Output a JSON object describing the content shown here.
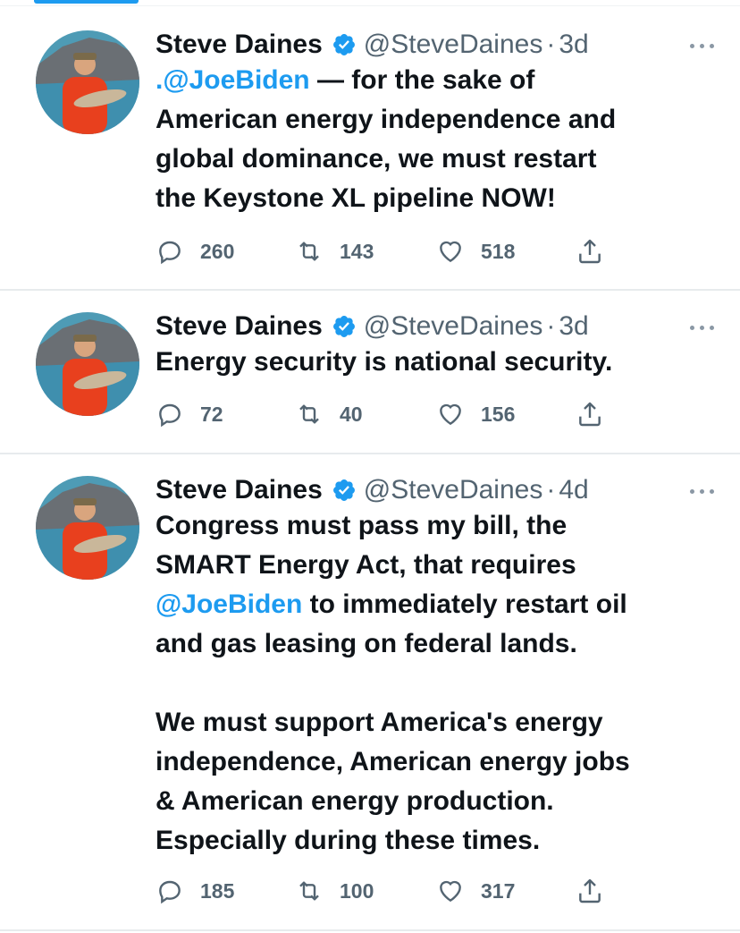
{
  "tweets": [
    {
      "author_name": "Steve Daines",
      "handle": "@SteveDaines",
      "separator": "·",
      "time": "3d",
      "text_parts": [
        {
          "t": ".@JoeBiden",
          "m": true
        },
        {
          "t": " — for the sake of\nAmerican energy independence and\nglobal dominance, we must restart\nthe Keystone XL pipeline NOW!",
          "m": false
        }
      ],
      "replies": "260",
      "retweets": "143",
      "likes": "518"
    },
    {
      "author_name": "Steve Daines",
      "handle": "@SteveDaines",
      "separator": "·",
      "time": "3d",
      "text_parts": [
        {
          "t": "Energy security is national security.",
          "m": false
        }
      ],
      "replies": "72",
      "retweets": "40",
      "likes": "156"
    },
    {
      "author_name": "Steve Daines",
      "handle": "@SteveDaines",
      "separator": "·",
      "time": "4d",
      "text_parts": [
        {
          "t": "Congress must pass my bill, the\nSMART Energy Act, that requires\n",
          "m": false
        },
        {
          "t": "@JoeBiden",
          "m": true
        },
        {
          "t": " to immediately restart oil\nand gas leasing on federal lands.\n\nWe must support America's energy\nindependence, American energy jobs\n& American energy production.\nEspecially during these times.",
          "m": false
        }
      ],
      "replies": "185",
      "retweets": "100",
      "likes": "317"
    }
  ],
  "icons": {
    "verified": "verified-badge-icon",
    "more": "more-dots-icon",
    "reply": "reply-icon",
    "retweet": "retweet-icon",
    "like": "heart-icon",
    "share": "share-icon"
  },
  "colors": {
    "accent": "#1d9bf0",
    "text": "#0f1419",
    "muted": "#536471"
  }
}
